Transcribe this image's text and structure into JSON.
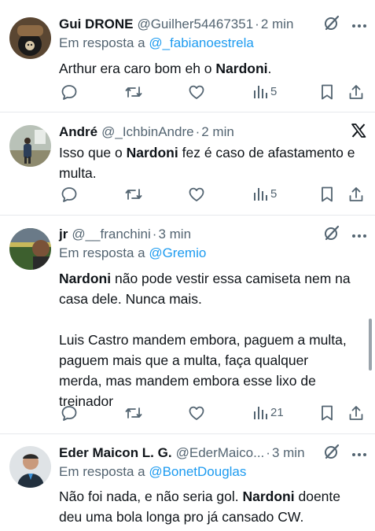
{
  "tweets": [
    {
      "name": "Gui DRONE",
      "handle": "@Guilher54467351",
      "sep": "·",
      "time": "2 min",
      "reply_prefix": "Em resposta a ",
      "reply_to": "@_fabianoestrela",
      "text_1": "Arthur era caro bom eh o ",
      "text_bold": "Nardoni",
      "text_2": ".",
      "views": "5"
    },
    {
      "name": "André",
      "handle": "@_IchbinAndre",
      "sep": "·",
      "time": "2 min",
      "text_1": "Isso que o ",
      "text_bold": "Nardoni",
      "text_2": " fez é caso de afastamento e",
      "text_3": "multa.",
      "views": "5"
    },
    {
      "name": "jr",
      "handle": "@__franchini",
      "sep": "·",
      "time": "3 min",
      "reply_prefix": "Em resposta a ",
      "reply_to": "@Gremio",
      "text_bold": "Nardoni",
      "text_1": " não pode vestir essa camiseta nem na",
      "text_2": "casa dele. Nunca mais.",
      "text_3": "Luis Castro mandem embora, paguem a multa,",
      "text_4": "paguem mais que a multa, faça qualquer",
      "text_5": "merda, mas mandem embora esse lixo de",
      "text_6": "treinador",
      "views": "21"
    },
    {
      "name": "Eder Maicon L. G.",
      "handle": "@EderMaico...",
      "sep": "·",
      "time": "3 min",
      "reply_prefix": "Em resposta a ",
      "reply_to": "@BonetDouglas",
      "text_1": "Não foi nada, e não seria gol. ",
      "text_bold": "Nardoni",
      "text_2": " doente",
      "text_3": "deu uma bola longa pro já cansado CW."
    }
  ],
  "icons": {
    "reply": "reply-icon",
    "retweet": "retweet-icon",
    "like": "like-icon",
    "views": "views-icon",
    "bookmark": "bookmark-icon",
    "share": "share-icon",
    "more": "more-icon",
    "grok": "grok-icon",
    "x_logo": "x-logo-icon"
  },
  "colors": {
    "text": "#0f1419",
    "secondary": "#536471",
    "link": "#1d9bf0",
    "divider": "#e6e9ec"
  }
}
